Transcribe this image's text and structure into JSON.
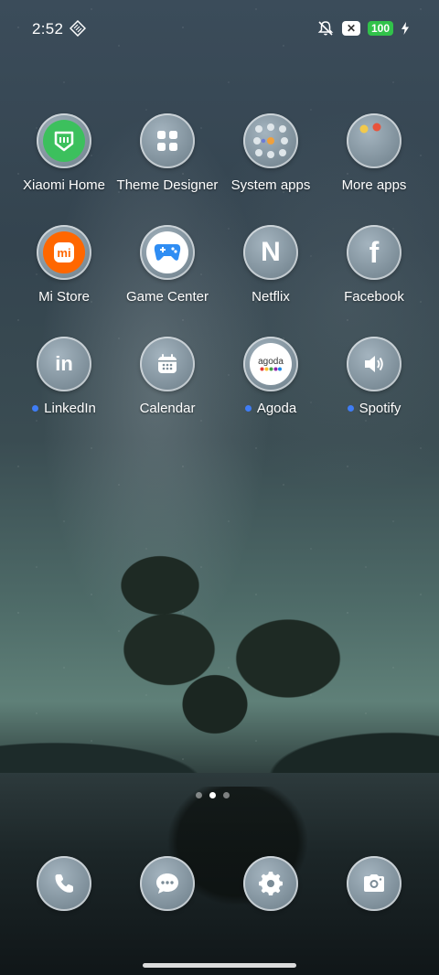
{
  "status": {
    "time": "2:52",
    "battery": "100",
    "notification_badge": "✕"
  },
  "apps": [
    {
      "label": "Xiaomi Home",
      "icon": "xiaomi-home-icon",
      "dot": false
    },
    {
      "label": "Theme Designer",
      "icon": "theme-designer-icon",
      "dot": false
    },
    {
      "label": "System apps",
      "icon": "folder-icon",
      "dot": false
    },
    {
      "label": "More apps",
      "icon": "folder-icon",
      "dot": false
    },
    {
      "label": "Mi Store",
      "icon": "mi-store-icon",
      "dot": false
    },
    {
      "label": "Game Center",
      "icon": "game-center-icon",
      "dot": false
    },
    {
      "label": "Netflix",
      "icon": "netflix-icon",
      "dot": false
    },
    {
      "label": "Facebook",
      "icon": "facebook-icon",
      "dot": false
    },
    {
      "label": "LinkedIn",
      "icon": "linkedin-icon",
      "dot": true
    },
    {
      "label": "Calendar",
      "icon": "calendar-icon",
      "dot": false
    },
    {
      "label": "Agoda",
      "icon": "agoda-icon",
      "dot": true
    },
    {
      "label": "Spotify",
      "icon": "speaker-icon",
      "dot": true
    }
  ],
  "agoda_text": "agoda",
  "mi_text": "mi",
  "netflix_text": "N",
  "facebook_text": "f",
  "linkedin_text": "in",
  "dock": [
    "phone-icon",
    "messages-icon",
    "settings-icon",
    "camera-icon"
  ],
  "colors": {
    "battery_green": "#31c24a",
    "notification_dot": "#3f7df6",
    "mi_orange": "#ff6700",
    "xiaomi_home_green": "#3cc05d"
  }
}
